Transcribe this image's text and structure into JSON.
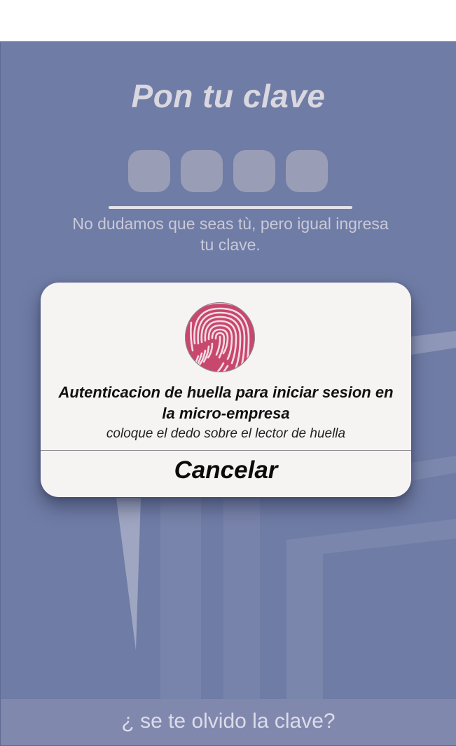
{
  "screen": {
    "title": "Pon tu clave",
    "pin_slots": [
      "",
      "",
      "",
      ""
    ],
    "subtitle": "No dudamos que seas tù, pero igual ingresa tu clave."
  },
  "dialog": {
    "icon": "fingerprint-icon",
    "title": "Autenticacion de huella para iniciar sesion en la micro-empresa",
    "message": "coloque el dedo sobre el lector de huella",
    "cancel_label": "Cancelar"
  },
  "footer": {
    "forgot_label": "¿ se te olvido la clave?"
  },
  "colors": {
    "background": "#6f7ca5",
    "dialog_background": "#f6f3f3",
    "fingerprint_accent": "#c0466c"
  }
}
